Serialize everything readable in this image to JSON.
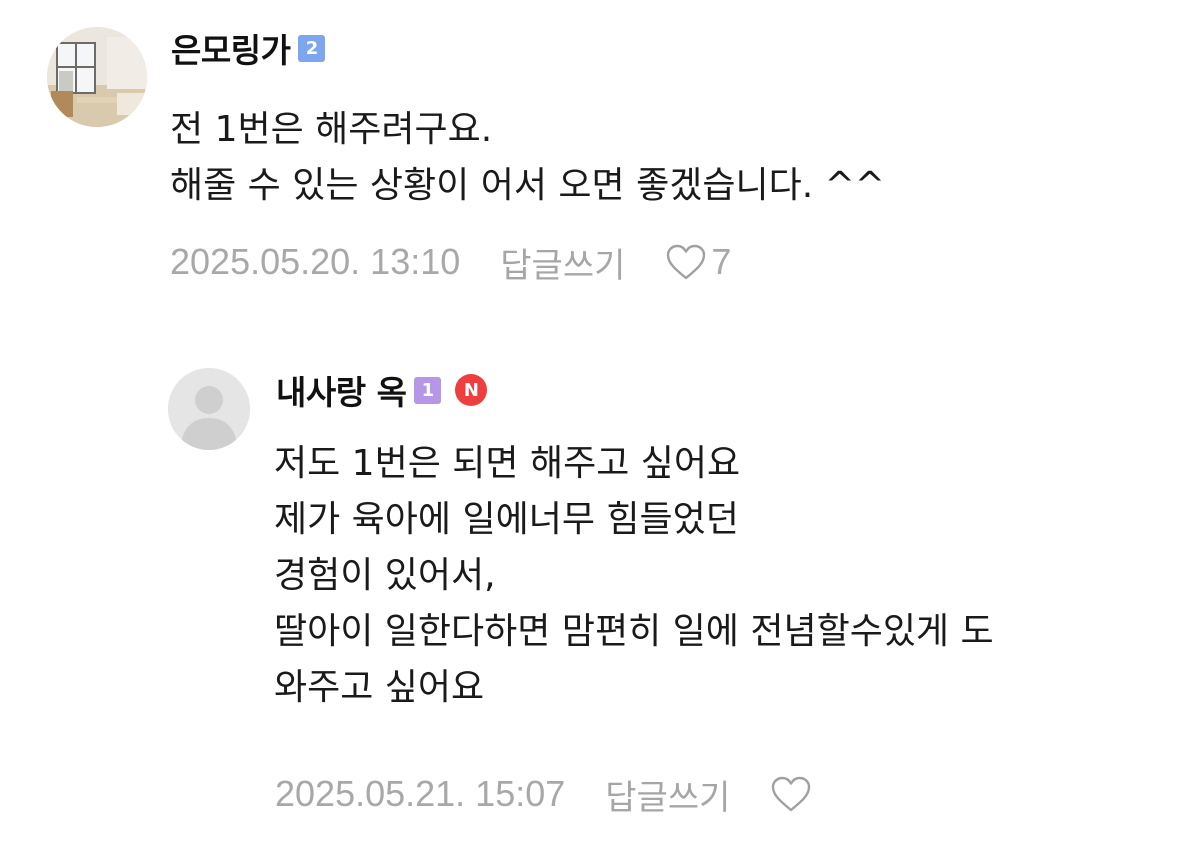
{
  "colors": {
    "level_badge_blue": "#7ea6ee",
    "level_badge_purple": "#b696e6",
    "new_badge_red": "#ef3e3e",
    "meta_gray": "#a8a8a8",
    "text": "#1a1a1a"
  },
  "comments": [
    {
      "author": "은모링가",
      "level_badge": "2",
      "avatar": "room-photo",
      "body": [
        "전 1번은 해주려구요.",
        "해줄 수 있는 상황이 어서 오면 좋겠습니다. ^^"
      ],
      "date": "2025.05.20. 13:10",
      "reply_label": "답글쓰기",
      "like_icon": "heart-outline-icon",
      "like_count": "7"
    },
    {
      "author": "내사랑 옥",
      "level_badge": "1",
      "new_badge": "N",
      "avatar": "default-user-icon",
      "body": [
        "저도 1번은 되면 해주고 싶어요",
        "제가 육아에 일에너무 힘들었던",
        "경험이 있어서,",
        "딸아이 일한다하면 맘편히 일에 전념할수있게 도",
        "와주고 싶어요"
      ],
      "date": "2025.05.21. 15:07",
      "reply_label": "답글쓰기",
      "like_icon": "heart-outline-icon",
      "like_count": ""
    }
  ]
}
